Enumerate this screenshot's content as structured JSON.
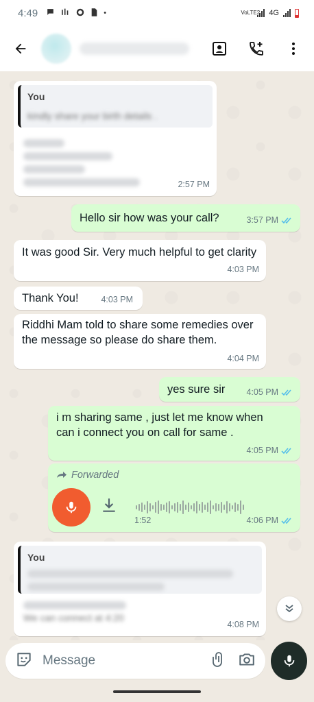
{
  "status_bar": {
    "time": "4:49",
    "network_label": "VoLTE2",
    "network_type": "4G"
  },
  "header": {
    "back_icon": "arrow-left-icon",
    "actions": [
      "contact-card-icon",
      "add-call-icon",
      "more-vert-icon"
    ]
  },
  "messages": [
    {
      "type": "reply",
      "direction": "incoming",
      "quote_author": "You",
      "quote_text": "kindly share your birth details .",
      "time": "2:57 PM"
    },
    {
      "type": "text",
      "direction": "outgoing",
      "text": "Hello sir how was your call?",
      "time": "3:57 PM",
      "status": "read"
    },
    {
      "type": "text",
      "direction": "incoming",
      "text": "It was good Sir. Very much helpful to get clarity",
      "time": "4:03 PM"
    },
    {
      "type": "text",
      "direction": "incoming",
      "text": "Thank You!",
      "time": "4:03 PM"
    },
    {
      "type": "text",
      "direction": "incoming",
      "text": "Riddhi Mam told to share some remedies over the message so please do share them.",
      "time": "4:04 PM"
    },
    {
      "type": "text",
      "direction": "outgoing",
      "text": "yes sure sir",
      "time": "4:05 PM",
      "status": "read"
    },
    {
      "type": "text",
      "direction": "outgoing",
      "text": "i m sharing same , just let me know when can i connect you on call for same .",
      "time": "4:05 PM",
      "status": "read"
    },
    {
      "type": "voice",
      "direction": "outgoing",
      "forwarded_label": "Forwarded",
      "duration": "1:52",
      "time": "4:06 PM",
      "status": "read"
    },
    {
      "type": "reply",
      "direction": "incoming",
      "quote_author": "You",
      "body_text": "We can connect at 4:20",
      "time": "4:08 PM"
    }
  ],
  "composer": {
    "placeholder": "Message"
  },
  "colors": {
    "chat_bg": "#efeae2",
    "outgoing_bubble": "#d9fdd3",
    "incoming_bubble": "#ffffff",
    "read_ticks": "#53bdeb",
    "voice_mic": "#f15c2f"
  }
}
